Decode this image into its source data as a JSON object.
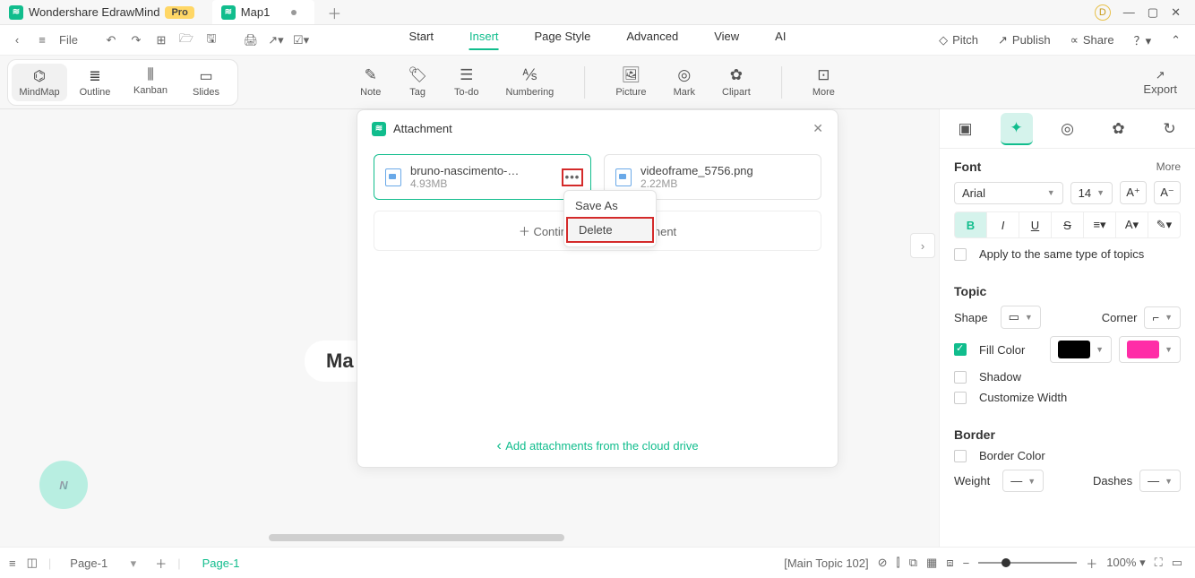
{
  "titlebar": {
    "appName": "Wondershare EdrawMind",
    "pro": "Pro",
    "docName": "Map1",
    "userInitial": "D"
  },
  "menubar": {
    "file": "File",
    "tabs": {
      "start": "Start",
      "insert": "Insert",
      "pageStyle": "Page Style",
      "advanced": "Advanced",
      "view": "View",
      "ai": "AI"
    },
    "right": {
      "pitch": "Pitch",
      "publish": "Publish",
      "share": "Share"
    }
  },
  "viewmodes": {
    "mindmap": "MindMap",
    "outline": "Outline",
    "kanban": "Kanban",
    "slides": "Slides"
  },
  "ribbon": {
    "note": "Note",
    "tag": "Tag",
    "todo": "To-do",
    "numbering": "Numbering",
    "picture": "Picture",
    "mark": "Mark",
    "clipart": "Clipart",
    "more": "More",
    "export": "Export"
  },
  "canvas": {
    "mainTopic": "Ma"
  },
  "dialog": {
    "title": "Attachment",
    "files": [
      {
        "name": "bruno-nascimento-PHIg...",
        "size": "4.93MB"
      },
      {
        "name": "videoframe_5756.png",
        "size": "2.22MB"
      }
    ],
    "addMore": "Continue to add attachment",
    "menu": {
      "saveAs": "Save As",
      "delete": "Delete"
    },
    "cloud": "Add attachments from the cloud drive"
  },
  "side": {
    "font": {
      "head": "Font",
      "more": "More",
      "family": "Arial",
      "size": "14",
      "apply": "Apply to the same type of topics"
    },
    "topic": {
      "head": "Topic",
      "shape": "Shape",
      "corner": "Corner",
      "fillColor": "Fill Color",
      "shadow": "Shadow",
      "customize": "Customize Width"
    },
    "border": {
      "head": "Border",
      "borderColor": "Border Color",
      "weight": "Weight",
      "dashes": "Dashes"
    },
    "colors": {
      "fillSwatch": "#000000",
      "fillPick": "#ff2da7"
    }
  },
  "status": {
    "page": "Page-1",
    "pageActive": "Page-1",
    "mainTopic": "[Main Topic 102]",
    "zoom": "100%"
  }
}
